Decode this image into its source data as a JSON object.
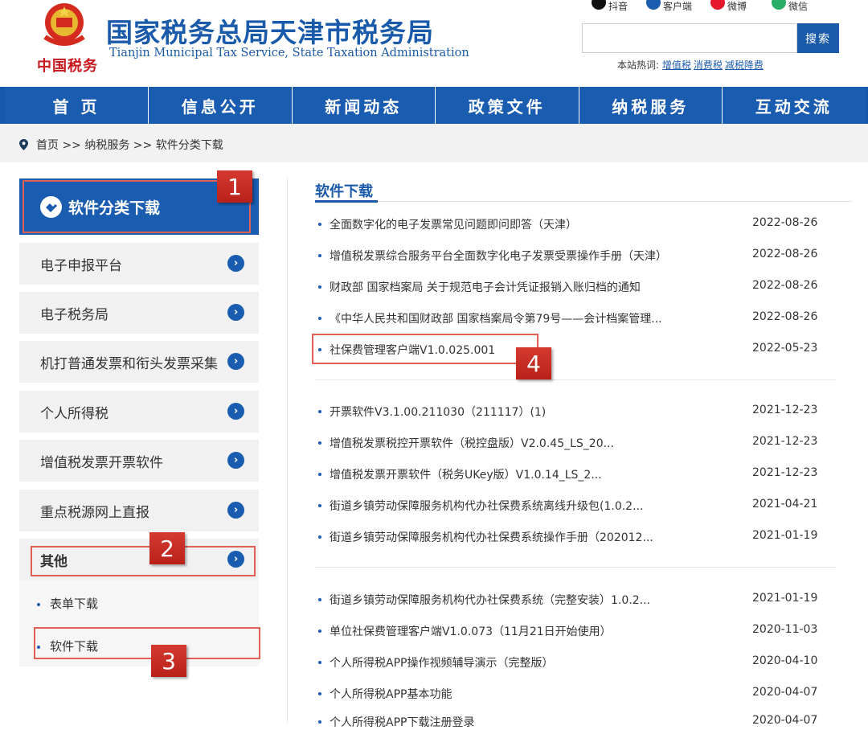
{
  "header": {
    "brand_mark": "中国税务",
    "title": "国家税务总局天津市税务局",
    "subtitle": "Tianjin Municipal Tax Service, State Taxation Administration",
    "social": [
      {
        "label": "抖音",
        "icon": "douyin-icon",
        "color": "#111111"
      },
      {
        "label": "客户端",
        "icon": "client-icon",
        "color": "#1a5cb0"
      },
      {
        "label": "微博",
        "icon": "weibo-icon",
        "color": "#e6162d"
      },
      {
        "label": "微信",
        "icon": "wechat-icon",
        "color": "#2aae67"
      }
    ],
    "search": {
      "placeholder": "",
      "button": "搜索"
    },
    "hot_label": "本站热词:",
    "hot_words": [
      "增值税",
      "消费税",
      "减税降费"
    ]
  },
  "nav": [
    "首 页",
    "信息公开",
    "新闻动态",
    "政策文件",
    "纳税服务",
    "互动交流"
  ],
  "breadcrumb": "首页 >> 纳税服务 >> 软件分类下载",
  "sidebar": {
    "heading": "软件分类下载",
    "items": [
      "电子申报平台",
      "电子税务局",
      "机打普通发票和衔头发票采集",
      "个人所得税",
      "增值税发票开票软件",
      "重点税源网上直报",
      "其他"
    ],
    "sub_items": [
      "表单下载",
      "软件下载"
    ]
  },
  "main": {
    "title": "软件下载",
    "groups": [
      [
        {
          "title": "全面数字化的电子发票常见问题即问即答（天津）",
          "date": "2022-08-26"
        },
        {
          "title": "增值税发票综合服务平台全面数字化电子发票受票操作手册（天津）",
          "date": "2022-08-26"
        },
        {
          "title": "财政部 国家档案局 关于规范电子会计凭证报销入账归档的通知",
          "date": "2022-08-26"
        },
        {
          "title": "《中华人民共和国财政部 国家档案局令第79号——会计档案管理...",
          "date": "2022-08-26"
        },
        {
          "title": "社保费管理客户端V1.0.025.001",
          "date": "2022-05-23"
        }
      ],
      [
        {
          "title": "开票软件V3.1.00.211030（211117）(1)",
          "date": "2021-12-23"
        },
        {
          "title": "增值税发票税控开票软件（税控盘版）V2.0.45_LS_20...",
          "date": "2021-12-23"
        },
        {
          "title": "增值税发票开票软件（税务UKey版）V1.0.14_LS_2...",
          "date": "2021-12-23"
        },
        {
          "title": "街道乡镇劳动保障服务机构代办社保费系统离线升级包(1.0.2...",
          "date": "2021-04-21"
        },
        {
          "title": "街道乡镇劳动保障服务机构代办社保费系统操作手册（202012...",
          "date": "2021-01-19"
        }
      ],
      [
        {
          "title": "街道乡镇劳动保障服务机构代办社保费系统（完整安装）1.0.2...",
          "date": "2021-01-19"
        },
        {
          "title": "单位社保费管理客户端V1.0.073（11月21日开始使用）",
          "date": "2020-11-03"
        },
        {
          "title": "个人所得税APP操作视频辅导演示（完整版）",
          "date": "2020-04-10"
        },
        {
          "title": "个人所得税APP基本功能",
          "date": "2020-04-07"
        },
        {
          "title": "个人所得税APP下载注册登录",
          "date": "2020-04-07"
        }
      ]
    ]
  },
  "annotations": [
    "1",
    "2",
    "3",
    "4"
  ],
  "colors": {
    "primary": "#1a5cb0",
    "annotation": "#c8261e",
    "brand_red": "#c8161d"
  }
}
